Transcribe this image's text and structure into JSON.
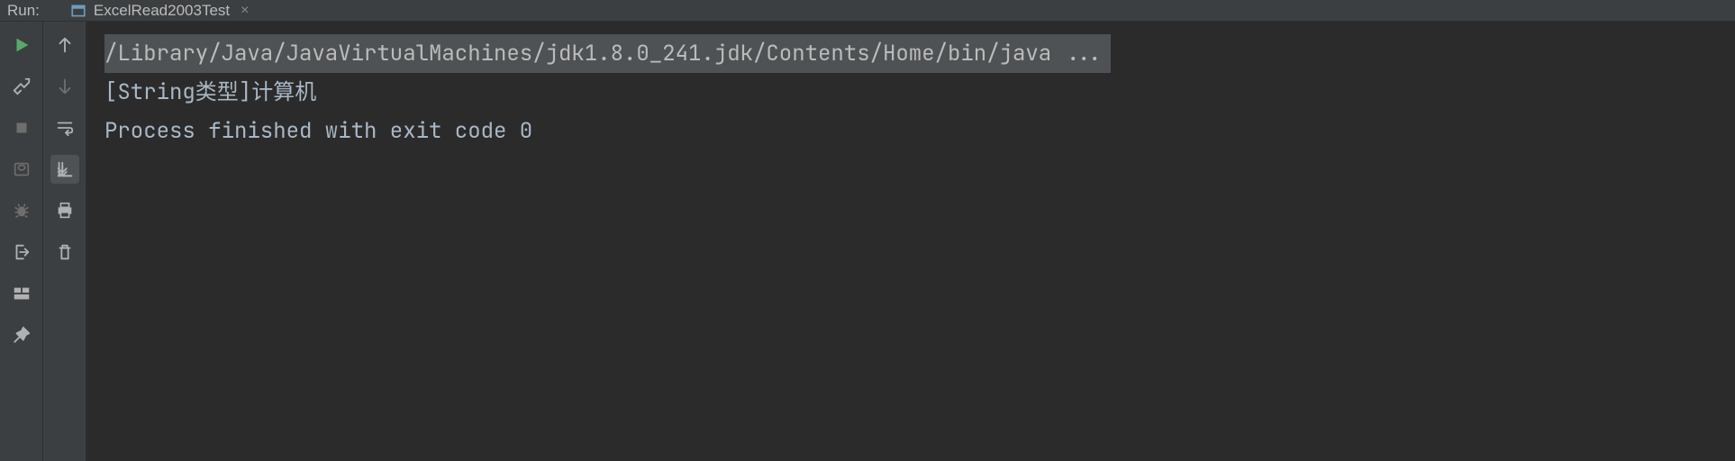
{
  "header": {
    "label": "Run:",
    "tab": {
      "name": "ExcelRead2003Test"
    }
  },
  "toolbar_left": {
    "run": "run",
    "settings": "settings",
    "stop": "stop",
    "camera": "camera",
    "debug": "debug",
    "exit": "exit",
    "layout": "layout",
    "pin": "pin"
  },
  "toolbar_secondary": {
    "up": "up",
    "down": "down",
    "wrap": "wrap",
    "scroll": "scroll",
    "print": "print",
    "clear": "clear"
  },
  "console": {
    "line1": "/Library/Java/JavaVirtualMachines/jdk1.8.0_241.jdk/Contents/Home/bin/java ...",
    "line2": "[String类型]计算机",
    "line3": "",
    "line4": "Process finished with exit code 0"
  }
}
